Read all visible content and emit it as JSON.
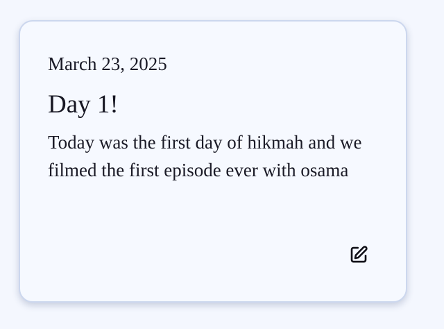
{
  "entry": {
    "date": "March 23, 2025",
    "title": "Day 1!",
    "body": "Today was the first day of hikmah and we filmed the first episode ever with osama"
  },
  "actions": {
    "edit_icon": "edit-icon"
  },
  "colors": {
    "page_background": "#f4f7fe",
    "card_background": "#f6f9ff",
    "card_border": "#ccd7ee",
    "text": "#161622"
  }
}
